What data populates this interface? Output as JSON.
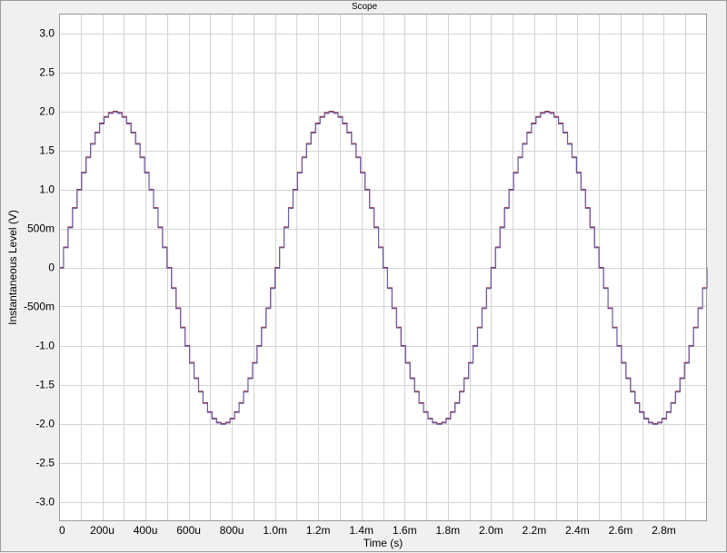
{
  "window": {
    "title": "Scope"
  },
  "chart_data": {
    "type": "line",
    "title": "Scope",
    "xlabel": "Time (s)",
    "ylabel": "Instantaneous Level (V)",
    "xlim": [
      0,
      0.003
    ],
    "ylim": [
      -3.25,
      3.25
    ],
    "grid": true,
    "x_ticks": [
      {
        "value": 0,
        "label": "0"
      },
      {
        "value": 0.0002,
        "label": "200u"
      },
      {
        "value": 0.0004,
        "label": "400u"
      },
      {
        "value": 0.0006,
        "label": "600u"
      },
      {
        "value": 0.0008,
        "label": "800u"
      },
      {
        "value": 0.001,
        "label": "1.0m"
      },
      {
        "value": 0.0012,
        "label": "1.2m"
      },
      {
        "value": 0.0014,
        "label": "1.4m"
      },
      {
        "value": 0.0016,
        "label": "1.6m"
      },
      {
        "value": 0.0018,
        "label": "1.8m"
      },
      {
        "value": 0.002,
        "label": "2.0m"
      },
      {
        "value": 0.0022,
        "label": "2.2m"
      },
      {
        "value": 0.0024,
        "label": "2.4m"
      },
      {
        "value": 0.0026,
        "label": "2.6m"
      },
      {
        "value": 0.0028,
        "label": "2.8m"
      }
    ],
    "y_ticks": [
      {
        "value": 3.0,
        "label": "3.0"
      },
      {
        "value": 2.5,
        "label": "2.5"
      },
      {
        "value": 2.0,
        "label": "2.0"
      },
      {
        "value": 1.5,
        "label": "1.5"
      },
      {
        "value": 1.0,
        "label": "1.0"
      },
      {
        "value": 0.5,
        "label": "500m"
      },
      {
        "value": 0,
        "label": "0"
      },
      {
        "value": -0.5,
        "label": "-500m"
      },
      {
        "value": -1.0,
        "label": "-1.0"
      },
      {
        "value": -1.5,
        "label": "-1.5"
      },
      {
        "value": -2.0,
        "label": "-2.0"
      },
      {
        "value": -2.5,
        "label": "-2.5"
      },
      {
        "value": -3.0,
        "label": "-3.0"
      }
    ],
    "series": [
      {
        "color": "#a0303c",
        "style": "stepped sine",
        "amplitude": 2.0,
        "frequency_hz": 1000,
        "sample_rate_hz": 48000,
        "x_range": [
          0,
          0.003
        ]
      },
      {
        "color": "#6a5aa8",
        "style": "stepped sine",
        "amplitude": 2.0,
        "frequency_hz": 1000,
        "sample_rate_hz": 48000,
        "x_range": [
          0,
          0.003
        ]
      }
    ]
  }
}
